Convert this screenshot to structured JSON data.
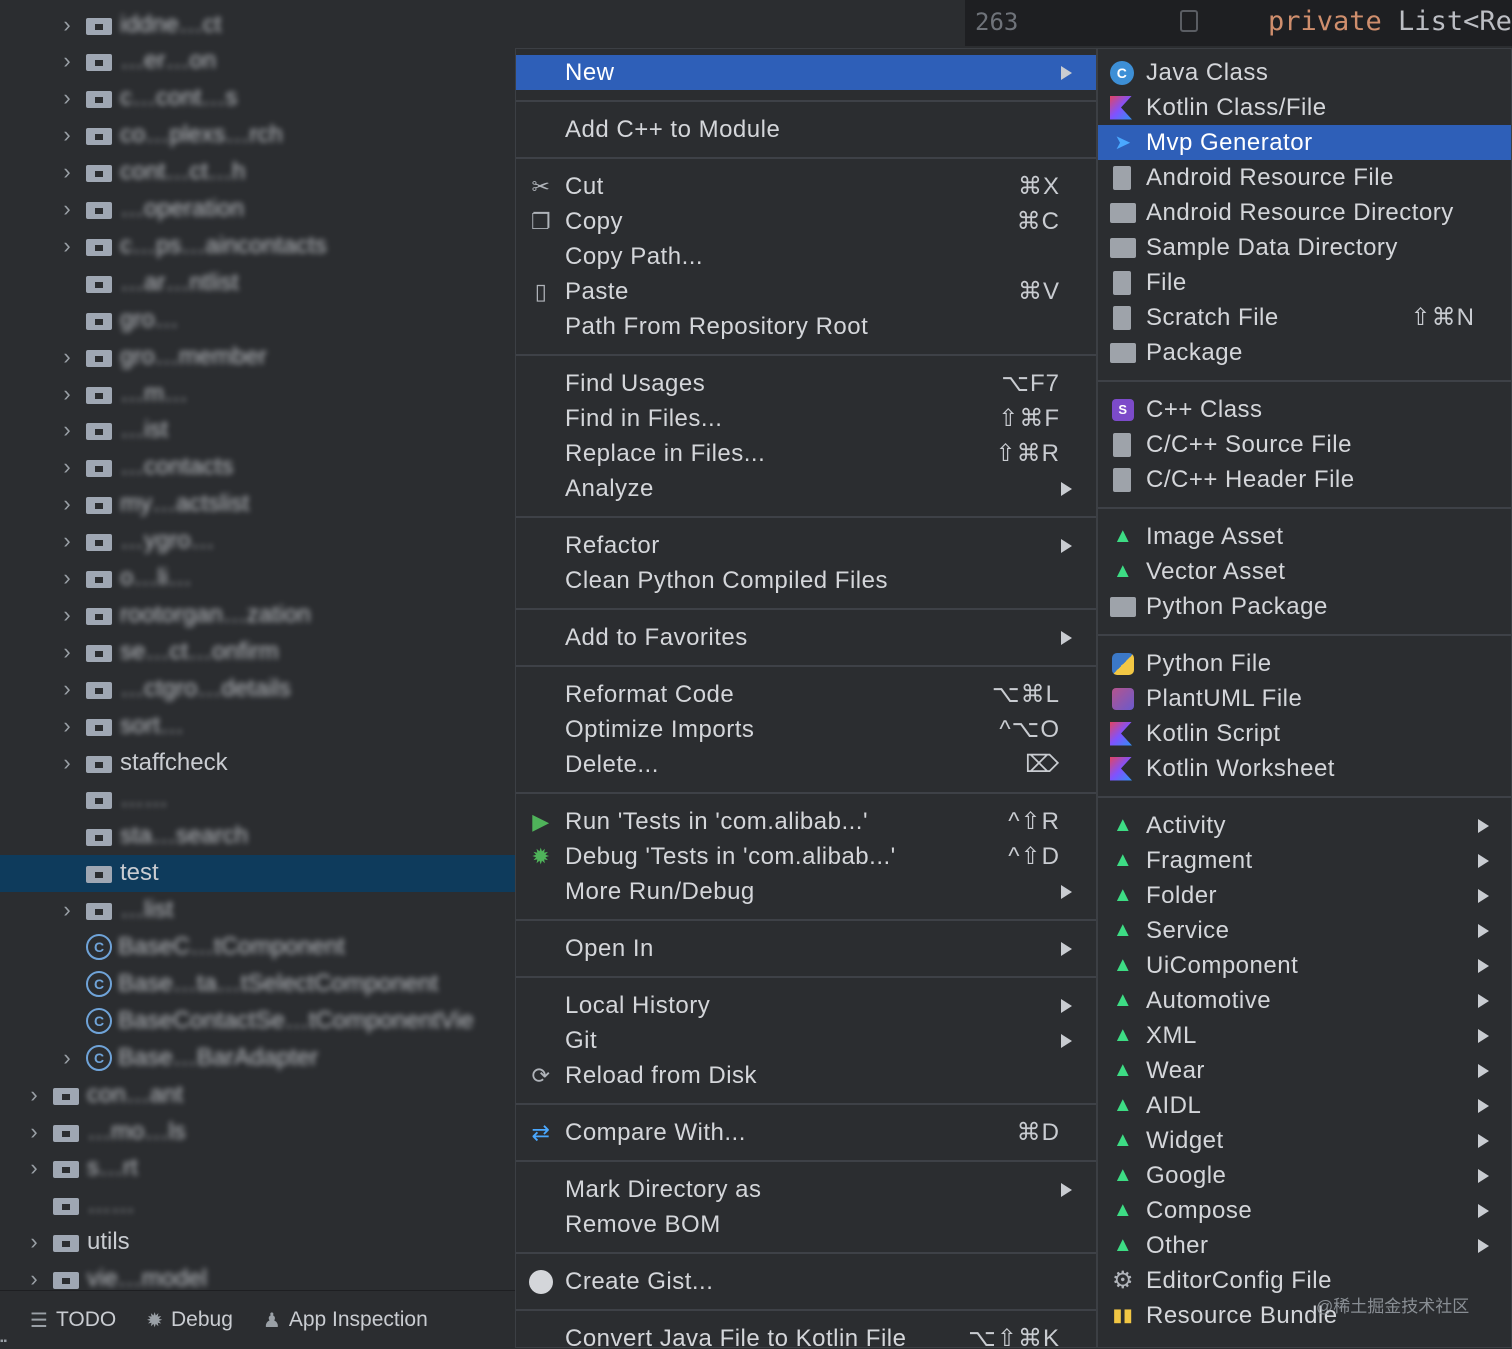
{
  "editor": {
    "line_number": "263",
    "code_keyword": "private",
    "code_rest": " List<Re"
  },
  "tree": {
    "rows": [
      {
        "label": "iddne…ct",
        "icon": "folder-icon",
        "chevron": true
      },
      {
        "label": "…er…on",
        "icon": "folder-icon",
        "chevron": true
      },
      {
        "label": "c…cont…s",
        "icon": "folder-icon",
        "chevron": true
      },
      {
        "label": "co…plexs…rch",
        "icon": "folder-icon",
        "chevron": true
      },
      {
        "label": "cont…ct…h",
        "icon": "folder-icon",
        "chevron": true
      },
      {
        "label": "…operation",
        "icon": "folder-icon",
        "chevron": true
      },
      {
        "label": "c…ps…aincontacts",
        "icon": "folder-icon",
        "chevron": true
      },
      {
        "label": "…ar…ntlist",
        "icon": "folder-icon",
        "chevron": false
      },
      {
        "label": "gro…",
        "icon": "folder-icon",
        "chevron": false
      },
      {
        "label": "gro…member",
        "icon": "folder-icon",
        "chevron": true
      },
      {
        "label": "…m…",
        "icon": "folder-icon",
        "chevron": true
      },
      {
        "label": "…ist",
        "icon": "folder-icon",
        "chevron": true
      },
      {
        "label": "…contacts",
        "icon": "folder-icon",
        "chevron": true
      },
      {
        "label": "my…actslist",
        "icon": "folder-icon",
        "chevron": true
      },
      {
        "label": "…ygro…",
        "icon": "folder-icon",
        "chevron": true
      },
      {
        "label": "o…li…",
        "icon": "folder-icon",
        "chevron": true
      },
      {
        "label": "rootorgan…zation",
        "icon": "folder-icon",
        "chevron": true
      },
      {
        "label": "se…ct…onfirm",
        "icon": "folder-icon",
        "chevron": true
      },
      {
        "label": "…ctgro…details",
        "icon": "folder-icon",
        "chevron": true
      },
      {
        "label": "sort…",
        "icon": "folder-icon",
        "chevron": true
      },
      {
        "label": "staffcheck",
        "icon": "folder-icon",
        "chevron": true
      },
      {
        "label": "……",
        "icon": "folder-icon",
        "chevron": false
      },
      {
        "label": "sta…search",
        "icon": "folder-icon",
        "chevron": false
      },
      {
        "label": "test",
        "icon": "folder-icon",
        "chevron": false,
        "selected": true
      },
      {
        "label": "…list",
        "icon": "folder-icon",
        "chevron": true
      },
      {
        "label": "BaseC…tComponent",
        "icon": "class-icon",
        "chevron": false
      },
      {
        "label": "Base…ta…tSelectComponent",
        "icon": "class-icon",
        "chevron": false
      },
      {
        "label": "BaseContactSe…tComponentVie",
        "icon": "class-icon",
        "chevron": false
      },
      {
        "label": "Base…BarAdapter",
        "icon": "class-icon",
        "chevron": true
      },
      {
        "label": "con…ant",
        "icon": "folder-icon",
        "chevron": true,
        "indent": 1
      },
      {
        "label": "…mo…ls",
        "icon": "folder-icon",
        "chevron": true,
        "indent": 1
      },
      {
        "label": "s…rt",
        "icon": "folder-icon",
        "chevron": true,
        "indent": 1
      },
      {
        "label": "……",
        "icon": "folder-icon",
        "chevron": false,
        "indent": 1
      },
      {
        "label": "utils",
        "icon": "folder-icon",
        "chevron": true,
        "indent": 1
      },
      {
        "label": "vie…model",
        "icon": "folder-icon",
        "chevron": true,
        "indent": 1
      }
    ]
  },
  "toolbar": {
    "todo": "TODO",
    "debug": "Debug",
    "app_inspection": "App Inspection"
  },
  "context_menu": {
    "items": [
      {
        "label": "New",
        "arrow": true,
        "highlighted": true
      },
      {
        "sep": true
      },
      {
        "label": "Add C++ to Module"
      },
      {
        "sep": true
      },
      {
        "label": "Cut",
        "shortcut": "⌘X",
        "icon": "scissors-icon"
      },
      {
        "label": "Copy",
        "shortcut": "⌘C",
        "icon": "copy-icon"
      },
      {
        "label": "Copy Path..."
      },
      {
        "label": "Paste",
        "shortcut": "⌘V",
        "icon": "clipboard-icon"
      },
      {
        "label": "Path From Repository Root"
      },
      {
        "sep": true
      },
      {
        "label": "Find Usages",
        "shortcut": "⌥F7"
      },
      {
        "label": "Find in Files...",
        "shortcut": "⇧⌘F"
      },
      {
        "label": "Replace in Files...",
        "shortcut": "⇧⌘R"
      },
      {
        "label": "Analyze",
        "arrow": true
      },
      {
        "sep": true
      },
      {
        "label": "Refactor",
        "arrow": true
      },
      {
        "label": "Clean Python Compiled Files"
      },
      {
        "sep": true
      },
      {
        "label": "Add to Favorites",
        "arrow": true
      },
      {
        "sep": true
      },
      {
        "label": "Reformat Code",
        "shortcut": "⌥⌘L"
      },
      {
        "label": "Optimize Imports",
        "shortcut": "^⌥O"
      },
      {
        "label": "Delete...",
        "shortcut": "⌦"
      },
      {
        "sep": true
      },
      {
        "label": "Run 'Tests in 'com.alibab...'",
        "shortcut": "^⇧R",
        "icon": "run-icon"
      },
      {
        "label": "Debug 'Tests in 'com.alibab...'",
        "shortcut": "^⇧D",
        "icon": "debug-bug-icon"
      },
      {
        "label": "More Run/Debug",
        "arrow": true
      },
      {
        "sep": true
      },
      {
        "label": "Open In",
        "arrow": true
      },
      {
        "sep": true
      },
      {
        "label": "Local History",
        "arrow": true
      },
      {
        "label": "Git",
        "arrow": true
      },
      {
        "label": "Reload from Disk",
        "icon": "reload-icon"
      },
      {
        "sep": true
      },
      {
        "label": "Compare With...",
        "shortcut": "⌘D",
        "icon": "compare-icon"
      },
      {
        "sep": true
      },
      {
        "label": "Mark Directory as",
        "arrow": true
      },
      {
        "label": "Remove BOM"
      },
      {
        "sep": true
      },
      {
        "label": "Create Gist...",
        "icon": "github-icon"
      },
      {
        "sep": true
      },
      {
        "label": "Convert Java File to Kotlin File",
        "shortcut": "⌥⇧⌘K"
      }
    ]
  },
  "new_submenu": {
    "items": [
      {
        "label": "Java Class",
        "icon": "java-class-icon"
      },
      {
        "label": "Kotlin Class/File",
        "icon": "kotlin-file-icon"
      },
      {
        "label": "Mvp Generator",
        "icon": "mvp-generator-icon",
        "highlighted": true
      },
      {
        "label": "Android Resource File",
        "icon": "android-resource-file-icon"
      },
      {
        "label": "Android Resource Directory",
        "icon": "folder-icon"
      },
      {
        "label": "Sample Data Directory",
        "icon": "folder-icon"
      },
      {
        "label": "File",
        "icon": "file-icon"
      },
      {
        "label": "Scratch File",
        "shortcut": "⇧⌘N",
        "icon": "scratch-file-icon"
      },
      {
        "label": "Package",
        "icon": "package-icon"
      },
      {
        "sep": true
      },
      {
        "label": "C++ Class",
        "icon": "cpp-class-icon"
      },
      {
        "label": "C/C++ Source File",
        "icon": "cpp-source-icon"
      },
      {
        "label": "C/C++ Header File",
        "icon": "cpp-header-icon"
      },
      {
        "sep": true
      },
      {
        "label": "Image Asset",
        "icon": "android-icon"
      },
      {
        "label": "Vector Asset",
        "icon": "android-icon"
      },
      {
        "label": "Python Package",
        "icon": "python-package-icon"
      },
      {
        "sep": true
      },
      {
        "label": "Python File",
        "icon": "python-icon"
      },
      {
        "label": "PlantUML File",
        "icon": "plantuml-icon"
      },
      {
        "label": "Kotlin Script",
        "icon": "kotlin-script-icon"
      },
      {
        "label": "Kotlin Worksheet",
        "icon": "kotlin-worksheet-icon"
      },
      {
        "sep": true
      },
      {
        "label": "Activity",
        "icon": "android-icon",
        "arrow": true
      },
      {
        "label": "Fragment",
        "icon": "android-icon",
        "arrow": true
      },
      {
        "label": "Folder",
        "icon": "android-icon",
        "arrow": true
      },
      {
        "label": "Service",
        "icon": "android-icon",
        "arrow": true
      },
      {
        "label": "UiComponent",
        "icon": "android-icon",
        "arrow": true
      },
      {
        "label": "Automotive",
        "icon": "android-icon",
        "arrow": true
      },
      {
        "label": "XML",
        "icon": "android-icon",
        "arrow": true
      },
      {
        "label": "Wear",
        "icon": "android-icon",
        "arrow": true
      },
      {
        "label": "AIDL",
        "icon": "android-icon",
        "arrow": true
      },
      {
        "label": "Widget",
        "icon": "android-icon",
        "arrow": true
      },
      {
        "label": "Google",
        "icon": "android-icon",
        "arrow": true
      },
      {
        "label": "Compose",
        "icon": "android-icon",
        "arrow": true
      },
      {
        "label": "Other",
        "icon": "android-icon",
        "arrow": true
      },
      {
        "label": "EditorConfig File",
        "icon": "gear-icon"
      },
      {
        "label": "Resource Bundle",
        "icon": "resource-bundle-icon"
      }
    ]
  },
  "watermark": "@稀土掘金技术社区",
  "colors": {
    "background": "#2b2d30",
    "highlight": "#2e5fb8",
    "selection": "#0e3b5c",
    "android_green": "#3ddc84"
  }
}
